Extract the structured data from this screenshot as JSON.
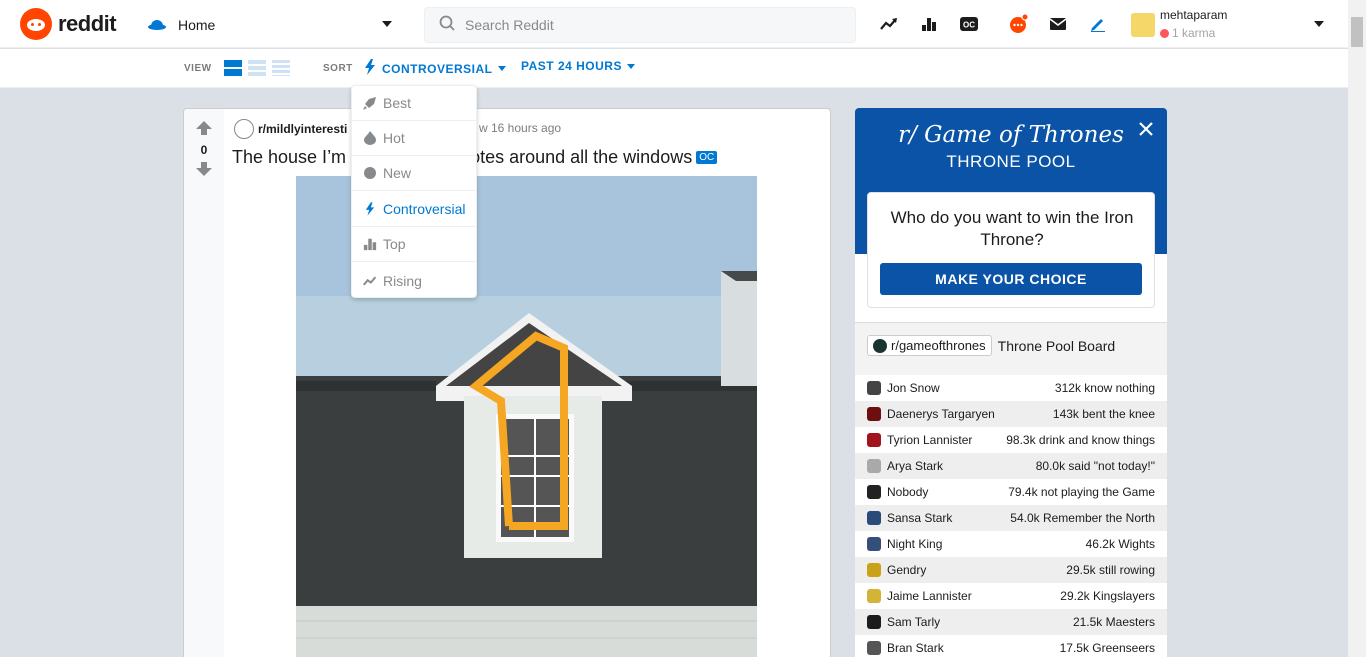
{
  "header": {
    "logo_text": "reddit",
    "home_label": "Home",
    "search_placeholder": "Search Reddit",
    "username": "mehtaparam",
    "karma": "1 karma"
  },
  "subbar": {
    "view_label": "VIEW",
    "sort_label": "SORT",
    "sort_value": "CONTROVERSIAL",
    "time_value": "PAST 24 HOURS"
  },
  "sort_menu": {
    "items": [
      {
        "label": "Best",
        "icon": "rocket-icon",
        "active": false
      },
      {
        "label": "Hot",
        "icon": "flame-icon",
        "active": false
      },
      {
        "label": "New",
        "icon": "sparkle-icon",
        "active": false
      },
      {
        "label": "Controversial",
        "icon": "bolt-icon",
        "active": true
      },
      {
        "label": "Top",
        "icon": "bars-icon",
        "active": false
      },
      {
        "label": "Rising",
        "icon": "trend-icon",
        "active": false
      }
    ]
  },
  "post": {
    "votes": "0",
    "subreddit": "r/mildlyinteresti",
    "time": "w 16 hours ago",
    "title": "The house I’m",
    "title_rest": "otes around all the windows",
    "badge": "OC"
  },
  "widget": {
    "title_line1": "r/ Game of Thrones",
    "title_line2": "THRONE POOL",
    "question": "Who do you want to win the Iron Throne?",
    "button": "MAKE YOUR CHOICE",
    "board_tag": "r/gameofthrones",
    "board_title": "Throne Pool Board",
    "rows": [
      {
        "name": "Jon Snow",
        "score": "312k know nothing",
        "color": "#444444"
      },
      {
        "name": "Daenerys Targaryen",
        "score": "143k bent the knee",
        "color": "#6b0f0f"
      },
      {
        "name": "Tyrion Lannister",
        "score": "98.3k drink and know things",
        "color": "#a3131a"
      },
      {
        "name": "Arya Stark",
        "score": "80.0k said \"not today!\"",
        "color": "#a9a9a9"
      },
      {
        "name": "Nobody",
        "score": "79.4k not playing the Game",
        "color": "#222222"
      },
      {
        "name": "Sansa Stark",
        "score": "54.0k Remember the North",
        "color": "#2a4a7a"
      },
      {
        "name": "Night King",
        "score": "46.2k Wights",
        "color": "#34507a"
      },
      {
        "name": "Gendry",
        "score": "29.5k still rowing",
        "color": "#c9a21a"
      },
      {
        "name": "Jaime Lannister",
        "score": "29.2k Kingslayers",
        "color": "#d4b436"
      },
      {
        "name": "Sam Tarly",
        "score": "21.5k Maesters",
        "color": "#1c1c1c"
      },
      {
        "name": "Bran Stark",
        "score": "17.5k Greenseers",
        "color": "#555555"
      }
    ]
  }
}
